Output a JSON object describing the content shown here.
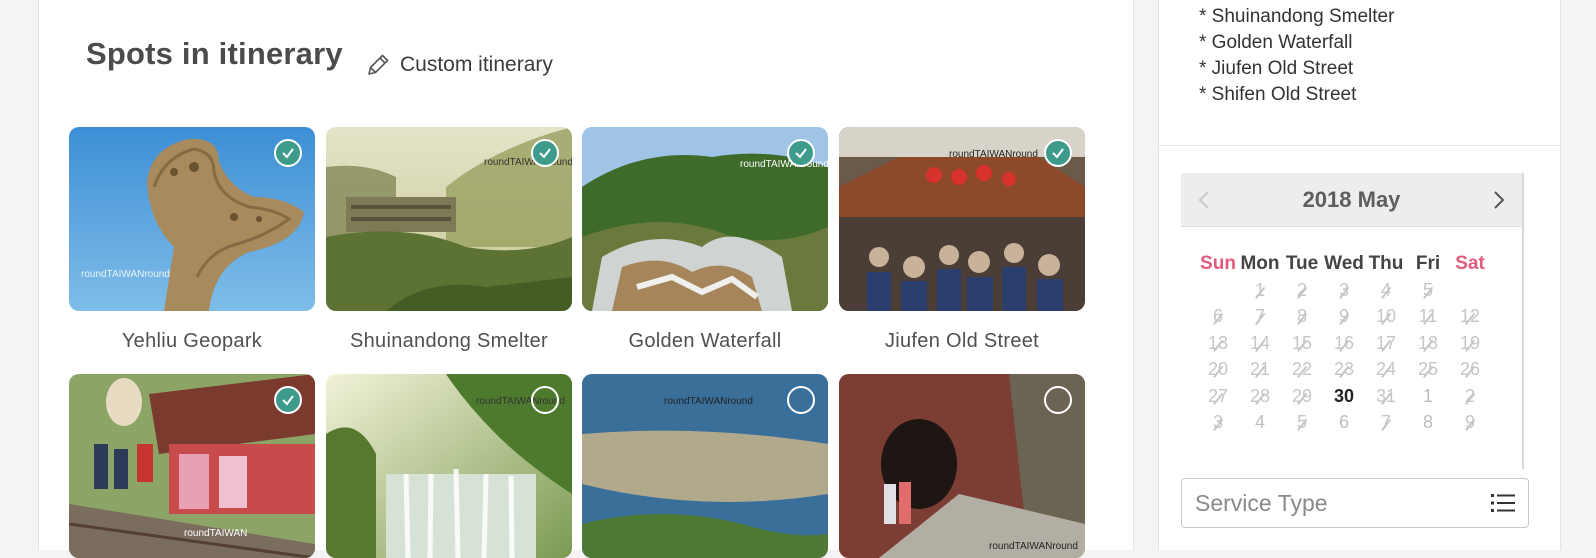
{
  "itinerary": {
    "title": "Spots in itinerary",
    "custom_link": "Custom itinerary",
    "spots": [
      {
        "name": "Yehliu Geopark",
        "selected": true,
        "watermark": "roundTAIWANround"
      },
      {
        "name": "Shuinandong Smelter",
        "selected": true,
        "watermark": "roundTAIWANround"
      },
      {
        "name": "Golden Waterfall",
        "selected": true,
        "watermark": "roundTAIWANround"
      },
      {
        "name": "Jiufen Old Street",
        "selected": true,
        "watermark": "roundTAIWANround"
      },
      {
        "name": "",
        "selected": true,
        "watermark": "roundTAIWAN"
      },
      {
        "name": "",
        "selected": false,
        "watermark": "roundTAIWANround"
      },
      {
        "name": "",
        "selected": false,
        "watermark": "roundTAIWANround"
      },
      {
        "name": "",
        "selected": false,
        "watermark": "roundTAIWANround"
      }
    ]
  },
  "sidebar": {
    "selected_list": [
      "* Shuinandong Smelter",
      "* Golden Waterfall",
      "* Jiufen Old Street",
      "* Shifen Old Street"
    ],
    "calendar": {
      "title": "2018 May",
      "prev_icon": "chevron-left-icon",
      "next_icon": "chevron-right-icon",
      "weekdays": [
        "Sun",
        "Mon",
        "Tue",
        "Wed",
        "Thu",
        "Fri",
        "Sat"
      ],
      "weekend_color": "#e25c7b",
      "weeks": [
        [
          "",
          "1",
          "2",
          "3",
          "4",
          "5",
          ""
        ],
        [
          "6",
          "7",
          "8",
          "9",
          "10",
          "11",
          "12"
        ],
        [
          "13",
          "14",
          "15",
          "16",
          "17",
          "18",
          "19"
        ],
        [
          "20",
          "21",
          "22",
          "23",
          "24",
          "25",
          "26"
        ],
        [
          "27",
          "28",
          "29",
          "30",
          "31",
          "1",
          "2"
        ],
        [
          "3",
          "4",
          "5",
          "6",
          "7",
          "8",
          "9"
        ]
      ],
      "today": "30"
    },
    "service_type": {
      "placeholder": "Service Type",
      "icon": "list-icon"
    }
  },
  "colors": {
    "accent": "#3e9b8c",
    "weekend": "#e25c7b"
  }
}
